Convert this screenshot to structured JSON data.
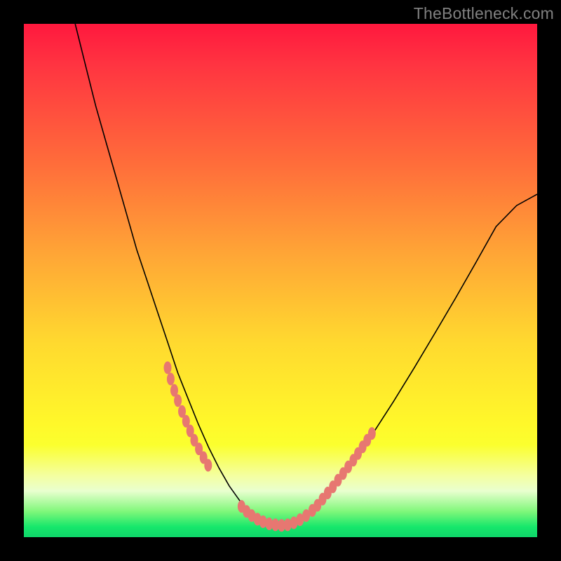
{
  "watermark": "TheBottleneck.com",
  "colors": {
    "background": "#000000",
    "gradient_top": "#ff183e",
    "gradient_mid": "#ffe12c",
    "gradient_bottom": "#0fd66a",
    "curve": "#000000",
    "dots": "#e77771"
  },
  "chart_data": {
    "type": "line",
    "title": "",
    "xlabel": "",
    "ylabel": "",
    "xlim": [
      0,
      100
    ],
    "ylim": [
      0,
      100
    ],
    "note": "No axes or tick labels are visible; x and y are in percent of plot area, y=0 at bottom.",
    "series": [
      {
        "name": "bottleneck-curve",
        "x": [
          10,
          12,
          14,
          16,
          18,
          20,
          22,
          24,
          26,
          28,
          30,
          32,
          34,
          36,
          38,
          40,
          42,
          43,
          44,
          46,
          48,
          50,
          52,
          54,
          56,
          60,
          64,
          68,
          72,
          76,
          80,
          84,
          88,
          92,
          96,
          100
        ],
        "y": [
          100,
          92,
          84,
          77,
          70,
          63,
          56,
          50,
          44,
          38,
          32,
          27,
          22,
          17.5,
          13.5,
          10,
          7.2,
          6.0,
          5.0,
          3.6,
          2.7,
          2.3,
          2.5,
          3.4,
          5.1,
          9.5,
          14.5,
          20.2,
          26.4,
          32.9,
          39.6,
          46.4,
          53.4,
          60.5,
          64.6,
          66.8
        ]
      }
    ],
    "dot_clusters": [
      {
        "name": "left-cluster",
        "approx_x_range": [
          28,
          36
        ],
        "approx_y_range": [
          14,
          33
        ],
        "points": [
          {
            "x": 28.0,
            "y": 33.0
          },
          {
            "x": 28.6,
            "y": 30.8
          },
          {
            "x": 29.3,
            "y": 28.6
          },
          {
            "x": 30.0,
            "y": 26.6
          },
          {
            "x": 30.8,
            "y": 24.5
          },
          {
            "x": 31.6,
            "y": 22.6
          },
          {
            "x": 32.4,
            "y": 20.7
          },
          {
            "x": 33.2,
            "y": 18.9
          },
          {
            "x": 34.1,
            "y": 17.2
          },
          {
            "x": 35.0,
            "y": 15.5
          },
          {
            "x": 35.9,
            "y": 14.0
          }
        ]
      },
      {
        "name": "valley-cluster",
        "approx_x_range": [
          42,
          56
        ],
        "approx_y_range": [
          2.3,
          6.0
        ],
        "points": [
          {
            "x": 42.4,
            "y": 6.0
          },
          {
            "x": 43.4,
            "y": 5.0
          },
          {
            "x": 44.4,
            "y": 4.2
          },
          {
            "x": 45.5,
            "y": 3.5
          },
          {
            "x": 46.6,
            "y": 3.0
          },
          {
            "x": 47.8,
            "y": 2.6
          },
          {
            "x": 49.0,
            "y": 2.4
          },
          {
            "x": 50.2,
            "y": 2.3
          },
          {
            "x": 51.4,
            "y": 2.4
          },
          {
            "x": 52.6,
            "y": 2.8
          },
          {
            "x": 53.8,
            "y": 3.4
          },
          {
            "x": 55.0,
            "y": 4.2
          },
          {
            "x": 56.2,
            "y": 5.2
          }
        ]
      },
      {
        "name": "right-cluster",
        "approx_x_range": [
          56,
          68
        ],
        "approx_y_range": [
          5,
          21
        ],
        "points": [
          {
            "x": 56.2,
            "y": 5.2
          },
          {
            "x": 57.2,
            "y": 6.2
          },
          {
            "x": 58.2,
            "y": 7.4
          },
          {
            "x": 59.2,
            "y": 8.6
          },
          {
            "x": 60.2,
            "y": 9.8
          },
          {
            "x": 61.2,
            "y": 11.1
          },
          {
            "x": 62.2,
            "y": 12.4
          },
          {
            "x": 63.2,
            "y": 13.7
          },
          {
            "x": 64.2,
            "y": 15.0
          },
          {
            "x": 65.1,
            "y": 16.3
          },
          {
            "x": 66.0,
            "y": 17.6
          },
          {
            "x": 66.9,
            "y": 18.9
          },
          {
            "x": 67.8,
            "y": 20.2
          }
        ]
      }
    ]
  }
}
